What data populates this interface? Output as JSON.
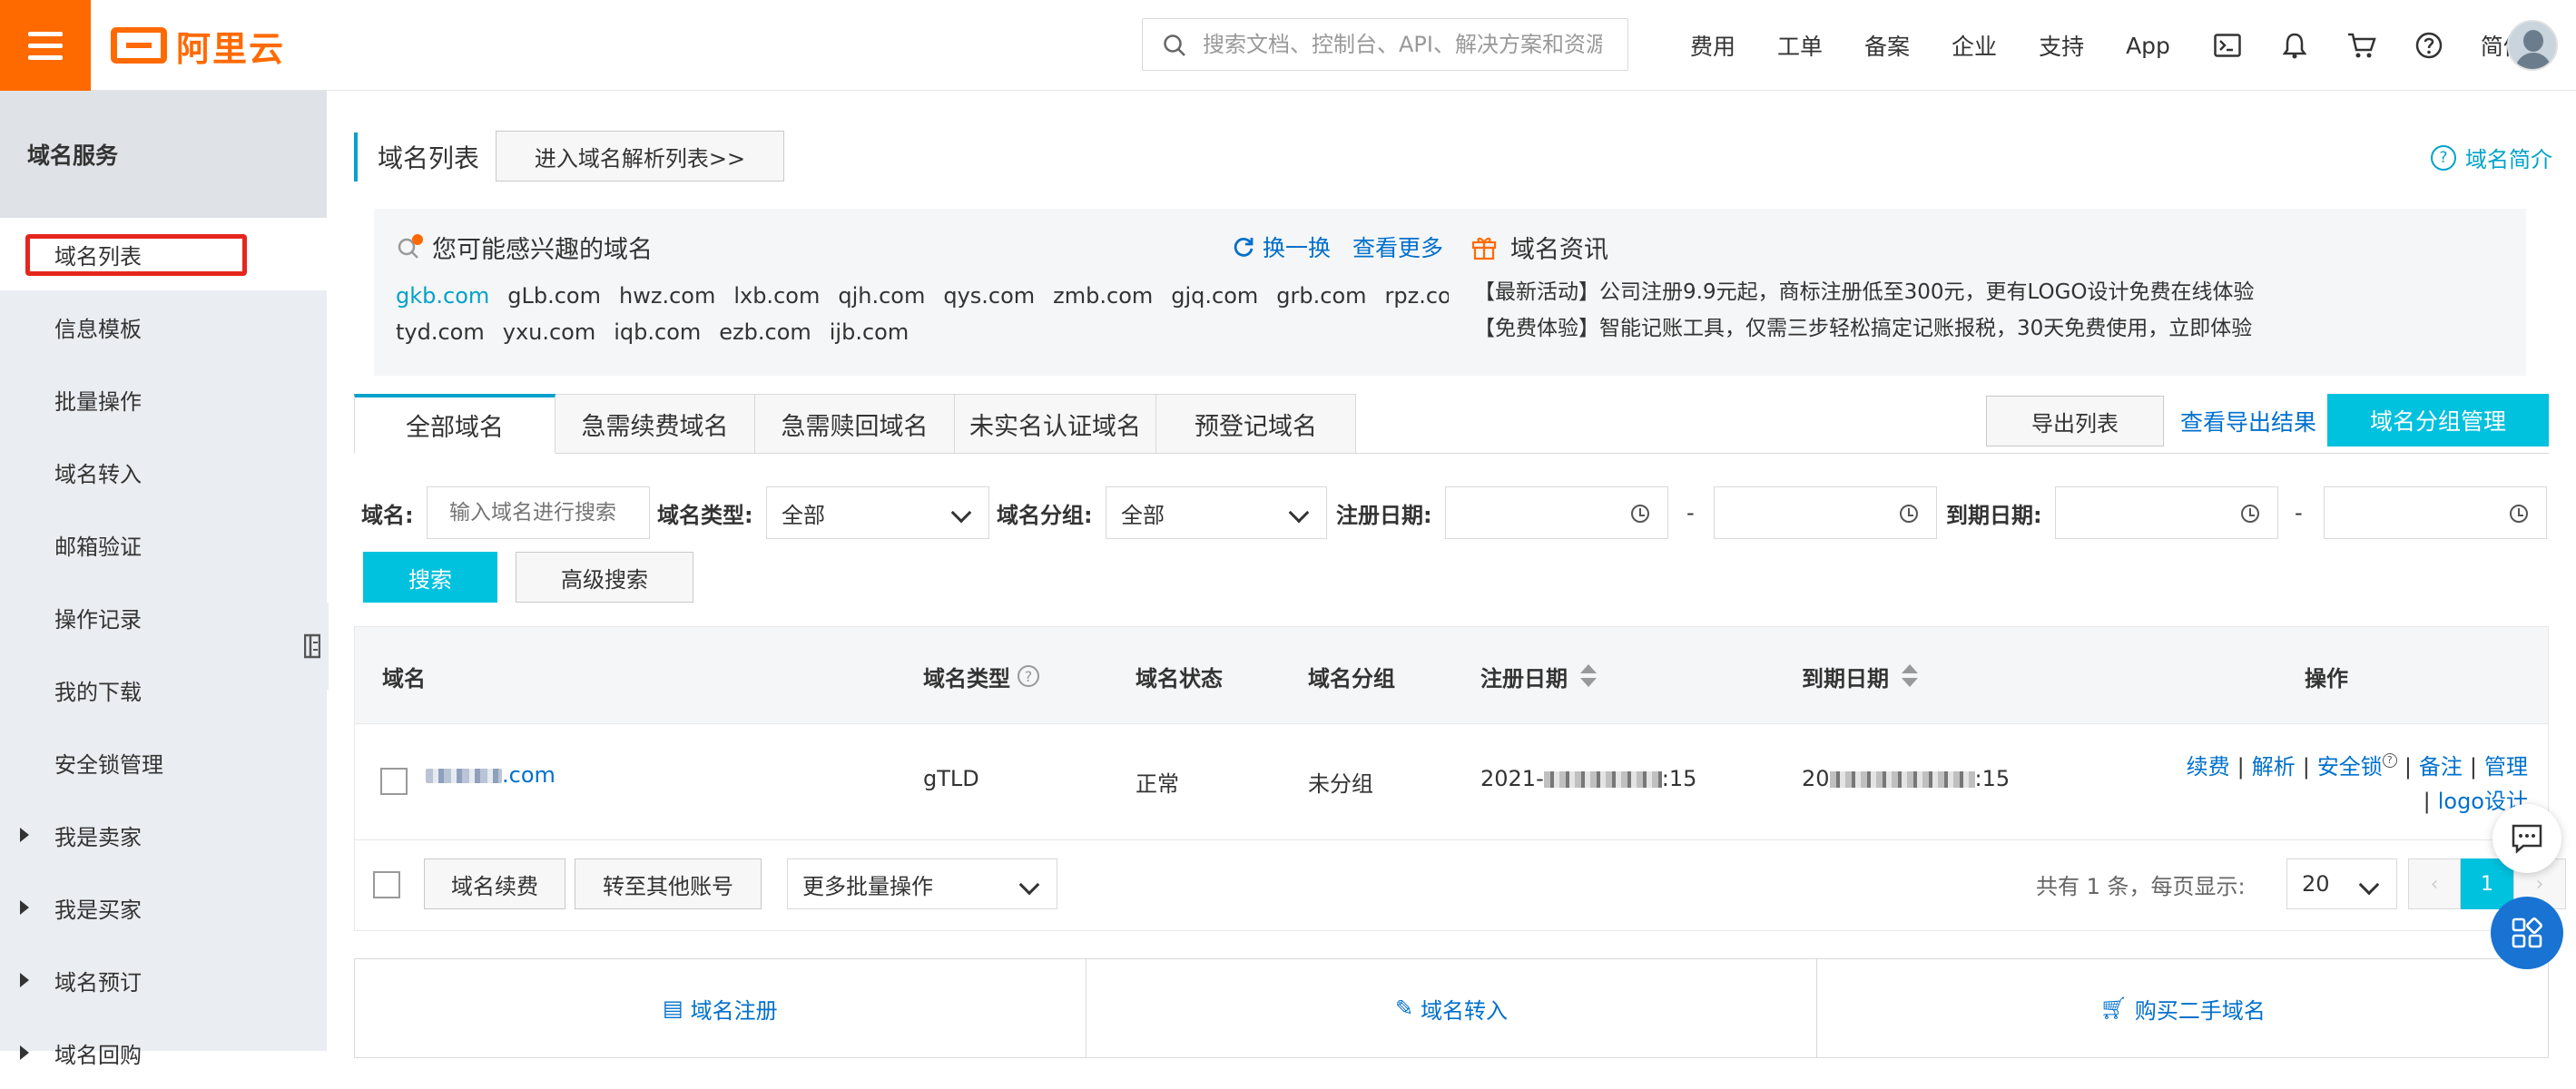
{
  "header": {
    "logo_text": "阿里云",
    "search_placeholder": "搜索文档、控制台、API、解决方案和资源",
    "nav": [
      "费用",
      "工单",
      "备案",
      "企业",
      "支持",
      "App"
    ],
    "lang": "简体",
    "icons": [
      "terminal-icon",
      "bell-icon",
      "cart-icon",
      "help-icon"
    ]
  },
  "sidebar": {
    "title": "域名服务",
    "items": [
      {
        "label": "域名列表",
        "active": true,
        "expandable": false
      },
      {
        "label": "信息模板",
        "expandable": false
      },
      {
        "label": "批量操作",
        "expandable": false
      },
      {
        "label": "域名转入",
        "expandable": false
      },
      {
        "label": "邮箱验证",
        "expandable": false
      },
      {
        "label": "操作记录",
        "expandable": false
      },
      {
        "label": "我的下载",
        "expandable": false
      },
      {
        "label": "安全锁管理",
        "expandable": false
      },
      {
        "label": "我是卖家",
        "expandable": true
      },
      {
        "label": "我是买家",
        "expandable": true
      },
      {
        "label": "域名预订",
        "expandable": true
      },
      {
        "label": "域名回购",
        "expandable": true
      }
    ]
  },
  "page": {
    "title": "域名列表",
    "goto_dns": "进入域名解析列表>>",
    "intro_link": "域名简介"
  },
  "suggest": {
    "title": "您可能感兴趣的域名",
    "refresh": "换一换",
    "more": "查看更多",
    "domains": [
      "gkb.com",
      "gLb.com",
      "hwz.com",
      "lxb.com",
      "qjh.com",
      "qys.com",
      "zmb.com",
      "gjq.com",
      "grb.com",
      "rpz.com",
      "tyd.com",
      "yxu.com",
      "iqb.com",
      "ezb.com",
      "ijb.com"
    ]
  },
  "news": {
    "title": "域名资讯",
    "lines": [
      "【最新活动】公司注册9.9元起，商标注册低至300元，更有LOGO设计免费在线体验",
      "【免费体验】智能记账工具，仅需三步轻松搞定记账报税，30天免费使用，立即体验"
    ]
  },
  "tabs": [
    "全部域名",
    "急需续费域名",
    "急需赎回域名",
    "未实名认证域名",
    "预登记域名"
  ],
  "toolbar": {
    "export": "导出列表",
    "export_result": "查看导出结果",
    "group_manage": "域名分组管理"
  },
  "filters": {
    "domain_label": "域名:",
    "domain_placeholder": "输入域名进行搜索",
    "type_label": "域名类型:",
    "type_value": "全部",
    "group_label": "域名分组:",
    "group_value": "全部",
    "reg_label": "注册日期:",
    "exp_label": "到期日期:",
    "dash": "-",
    "search": "搜索",
    "advanced": "高级搜索"
  },
  "table": {
    "headers": [
      "域名",
      "域名类型",
      "域名状态",
      "域名分组",
      "注册日期",
      "到期日期",
      "操作"
    ],
    "row": {
      "domain_suffix": ".com",
      "type": "gTLD",
      "status": "正常",
      "group": "未分组",
      "reg_prefix": "2021-",
      "reg_suffix": ":15",
      "exp_prefix": "20",
      "exp_suffix": ":15",
      "ops": [
        "续费",
        "解析",
        "安全锁",
        "备注",
        "管理",
        "logo设计"
      ]
    },
    "footer": {
      "renew": "域名续费",
      "transfer": "转至其他账号",
      "bulk": "更多批量操作",
      "page_info": "共有 1 条，每页显示:",
      "page_size": "20",
      "current_page": "1",
      "prev": "‹",
      "next": "›"
    }
  },
  "bottom": [
    "域名注册",
    "域名转入",
    "购买二手域名"
  ],
  "colors": {
    "brand": "#ff6a00",
    "accent": "#00c1de",
    "link": "#0070cc"
  }
}
